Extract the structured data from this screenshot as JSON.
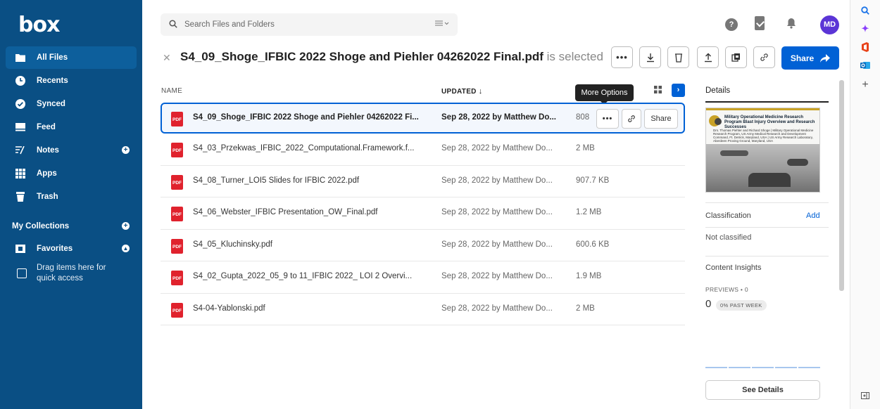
{
  "sidebar": {
    "logo": "box",
    "items": [
      {
        "label": "All Files",
        "icon": "folder-icon"
      },
      {
        "label": "Recents",
        "icon": "clock-icon"
      },
      {
        "label": "Synced",
        "icon": "check-circle-icon"
      },
      {
        "label": "Feed",
        "icon": "feed-icon"
      },
      {
        "label": "Notes",
        "icon": "notes-icon"
      },
      {
        "label": "Apps",
        "icon": "apps-grid-icon"
      },
      {
        "label": "Trash",
        "icon": "trash-icon"
      }
    ],
    "collections_title": "My Collections",
    "favorites_label": "Favorites",
    "drag_text": "Drag items here for quick access"
  },
  "search": {
    "placeholder": "Search Files and Folders"
  },
  "header": {
    "avatar_initials": "MD",
    "help_glyph": "?"
  },
  "selection": {
    "filename": "S4_09_Shoge_IFBIC 2022 Shoge and Piehler 04262022 Final.pdf",
    "suffix": "is selected",
    "share_label": "Share"
  },
  "table": {
    "headers": {
      "name": "NAME",
      "updated": "UPDATED"
    },
    "tooltip": "More Options",
    "rows": [
      {
        "name": "S4_09_Shoge_IFBIC 2022 Shoge and Piehler 04262022 Fi...",
        "updated": "Sep 28, 2022 by Matthew Do...",
        "size": "808",
        "selected": true
      },
      {
        "name": "S4_03_Przekwas_IFBIC_2022_Computational.Framework.f...",
        "updated": "Sep 28, 2022 by Matthew Do...",
        "size": "2 MB"
      },
      {
        "name": "S4_08_Turner_LOI5 Slides for IFBIC 2022.pdf",
        "updated": "Sep 28, 2022 by Matthew Do...",
        "size": "907.7 KB"
      },
      {
        "name": "S4_06_Webster_IFBIC Presentation_OW_Final.pdf",
        "updated": "Sep 28, 2022 by Matthew Do...",
        "size": "1.2 MB"
      },
      {
        "name": "S4_05_Kluchinsky.pdf",
        "updated": "Sep 28, 2022 by Matthew Do...",
        "size": "600.6 KB"
      },
      {
        "name": "S4_02_Gupta_2022_05_9 to 11_IFBIC 2022_ LOI 2 Overvi...",
        "updated": "Sep 28, 2022 by Matthew Do...",
        "size": "1.9 MB"
      },
      {
        "name": "S4-04-Yablonski.pdf",
        "updated": "Sep 28, 2022 by Matthew Do...",
        "size": "2 MB"
      }
    ],
    "row_share_label": "Share",
    "pdf_badge": "PDF"
  },
  "details": {
    "title": "Details",
    "thumb_heading": "Military Operational Medicine Research Program Blast Injury Overview and Research Successes",
    "thumb_sub": "Drs. Thomas Piehler and Richard Shoge | Military Operational Medicine Research Program, US Army Medical Research and Development Command, Ft. Detrick, Maryland, USA | US Army Research Laboratory, Aberdeen Proving Ground, Maryland, USA",
    "classification_label": "Classification",
    "add_label": "Add",
    "not_classified": "Not classified",
    "content_insights": "Content Insights",
    "previews_label": "PREVIEWS • 0",
    "previews_count": "0",
    "past_week": "0% PAST WEEK",
    "see_details": "See Details"
  },
  "colors": {
    "sidebar_bg": "#0a4f84",
    "accent": "#0061d5",
    "pdf_red": "#e0222d",
    "avatar": "#5b35d6"
  }
}
